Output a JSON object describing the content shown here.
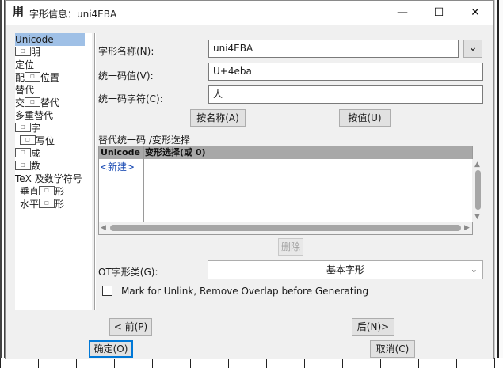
{
  "window": {
    "title": "字形信息：uni4EBA",
    "app_icon_glyph": "𤰆",
    "controls": {
      "minimize": "—",
      "maximize": "☐",
      "close": "✕"
    }
  },
  "sidebar": {
    "items": [
      {
        "label": "Unicode",
        "selected": true
      },
      {
        "parts": [
          "",
          "明"
        ]
      },
      {
        "label": "定位"
      },
      {
        "parts": [
          "配",
          "位置"
        ]
      },
      {
        "label": "替代"
      },
      {
        "parts": [
          "交",
          "替代"
        ]
      },
      {
        "label": "多重替代"
      },
      {
        "parts": [
          "",
          "字"
        ]
      },
      {
        "parts": [
          "",
          "写位"
        ]
      },
      {
        "parts": [
          "",
          "成"
        ]
      },
      {
        "parts": [
          "",
          "数"
        ]
      },
      {
        "label": "TeX 及数学符号"
      },
      {
        "parts": [
          "垂直",
          "形"
        ]
      },
      {
        "parts": [
          "水平",
          "形"
        ]
      }
    ]
  },
  "form": {
    "glyph_name_label": "字形名称(N):",
    "glyph_name_value": "uni4EBA",
    "unicode_value_label": "统一码值(V):",
    "unicode_value": "U+4eba",
    "unicode_char_label": "统一码字符(C):",
    "unicode_char": "人",
    "by_name_button": "按名称(A)",
    "by_value_button": "按值(U)",
    "dropdown_glyph": "⌄"
  },
  "alt_table": {
    "section_label": "替代统一码 /变形选择",
    "columns": [
      "Unicode",
      "变形选择(或 0)"
    ],
    "new_row_label": "<新建>",
    "delete_button": "删除"
  },
  "ot_class": {
    "label": "OT字形类(G):",
    "selected": "基本字形"
  },
  "unlink_checkbox": {
    "label": "Mark for Unlink, Remove Overlap before Generating",
    "checked": false
  },
  "nav": {
    "prev": "< 前(P)",
    "next": "后(N)>",
    "ok": "确定(O)",
    "cancel": "取消(C)"
  }
}
